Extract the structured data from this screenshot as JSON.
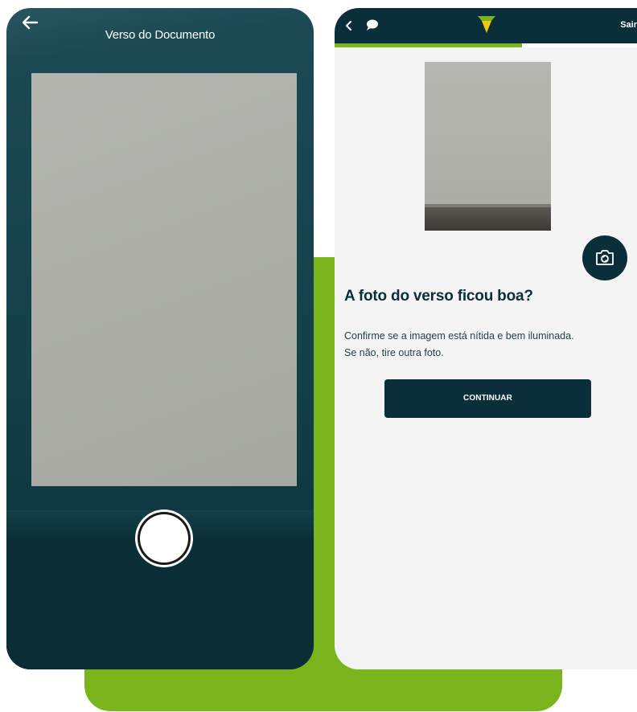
{
  "left_screen": {
    "title": "Verso do Documento",
    "back_icon": "arrow-left-icon",
    "shutter_icon": "camera-shutter-button"
  },
  "right_screen": {
    "header": {
      "back_icon": "chevron-left-icon",
      "chat_icon": "chat-bubble-icon",
      "logo_icon": "brand-logo-icon",
      "exit_label": "Sair"
    },
    "progress": 0.62,
    "retake_icon": "camera-icon",
    "heading": "A foto do verso ficou boa?",
    "line1": "Confirme se a imagem está nítida e bem iluminada.",
    "line2": "Se não, tire outra foto.",
    "continue_label": "CONTINUAR"
  },
  "colors": {
    "dark_teal": "#0a2f3b",
    "accent_green": "#7ab51d",
    "brand_yellow": "#f2c80f"
  }
}
